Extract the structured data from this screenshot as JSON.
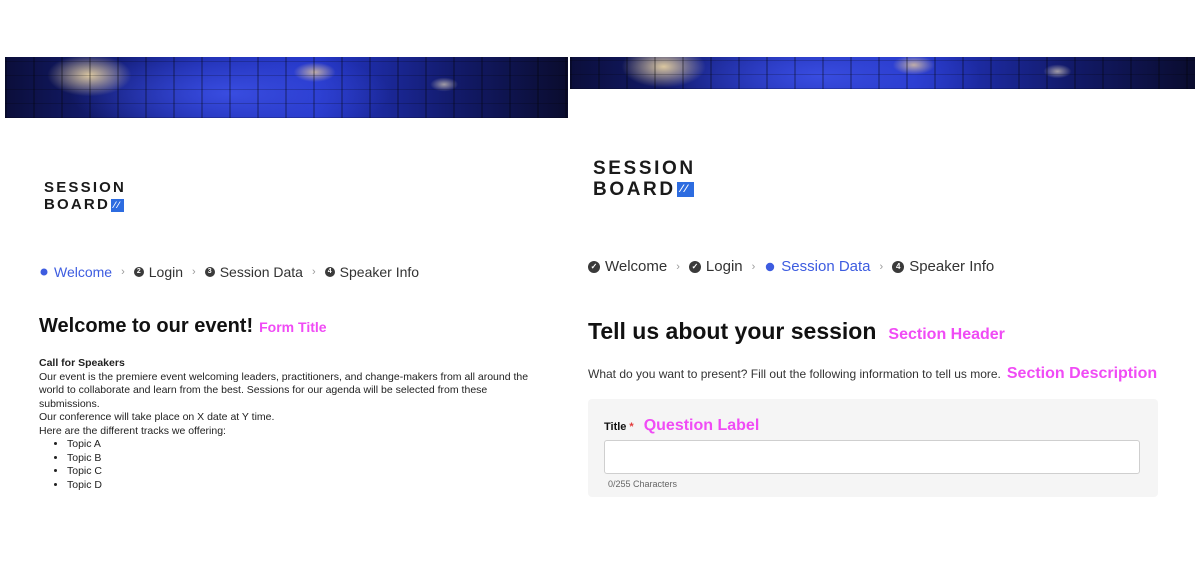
{
  "left": {
    "logo": {
      "line1": "SESSION",
      "line2": "BOARD",
      "mark": "⁄⁄"
    },
    "steps": [
      {
        "num": "",
        "label": "Welcome",
        "state": "active"
      },
      {
        "num": "2",
        "label": "Login",
        "state": "pending"
      },
      {
        "num": "3",
        "label": "Session Data",
        "state": "pending"
      },
      {
        "num": "4",
        "label": "Speaker Info",
        "state": "pending"
      }
    ],
    "form_title": "Welcome to our event!",
    "form_title_annotation": "Form Title",
    "body": {
      "heading": "Call for Speakers",
      "paragraph1": "Our event is the premiere event welcoming leaders, practitioners, and change-makers from all around the world to collaborate and learn from the best. Sessions for our agenda will be selected from these submissions.",
      "paragraph2": "Our conference will take place on X date at Y time.",
      "paragraph3": "Here are the different tracks we offering:",
      "topics": [
        "Topic A",
        "Topic B",
        "Topic C",
        "Topic D"
      ]
    }
  },
  "right": {
    "logo": {
      "line1": "SESSION",
      "line2": "BOARD",
      "mark": "⁄⁄"
    },
    "steps": [
      {
        "num": "✓",
        "label": "Welcome",
        "state": "done"
      },
      {
        "num": "✓",
        "label": "Login",
        "state": "done"
      },
      {
        "num": "",
        "label": "Session Data",
        "state": "active"
      },
      {
        "num": "4",
        "label": "Speaker Info",
        "state": "pending"
      }
    ],
    "section_header": "Tell us about your session",
    "section_header_annotation": "Section Header",
    "section_description": "What do you want to present? Fill out the following information to tell us more.",
    "section_description_annotation": "Section Description",
    "question": {
      "label": "Title",
      "required_mark": "*",
      "annotation": "Question Label",
      "value": "",
      "counter": "0/255 Characters"
    }
  },
  "colors": {
    "accent": "#3d5ce0",
    "annotation": "#f04bf5",
    "required": "#e23b3b",
    "logo_mark": "#2d6ce0"
  },
  "icons": {
    "chevron": "chevron-right-icon",
    "check": "check-circle-icon",
    "step_number": "numbered-circle-icon"
  }
}
